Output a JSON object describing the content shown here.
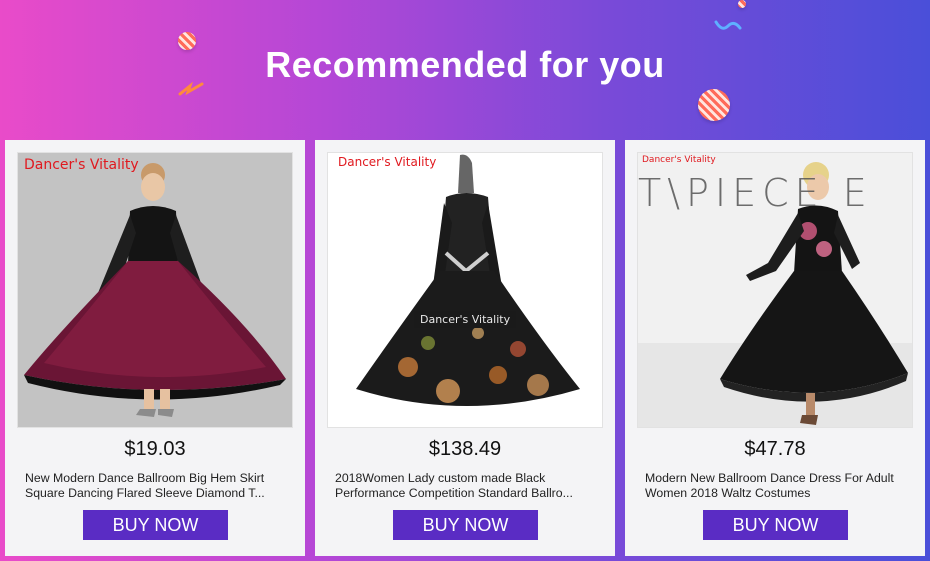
{
  "header": {
    "title": "Recommended for you"
  },
  "products": [
    {
      "brand": "Dancer's Vitality",
      "price": "$19.03",
      "title": "New Modern Dance Ballroom Big Hem Skirt Square Dancing Flared Sleeve Diamond T...",
      "buy_label": "BUY NOW"
    },
    {
      "brand": "Dancer's Vitality",
      "watermark": "Dancer's Vitality",
      "price": "$138.49",
      "title": "2018Women Lady custom made Black Performance Competition Standard Ballro...",
      "buy_label": "BUY NOW"
    },
    {
      "brand": "Dancer's Vitality",
      "backdrop_text": "T\\PIECE E",
      "price": "$47.78",
      "title": "Modern New Ballroom Dance Dress For Adult Women 2018 Waltz Costumes",
      "buy_label": "BUY NOW"
    }
  ]
}
